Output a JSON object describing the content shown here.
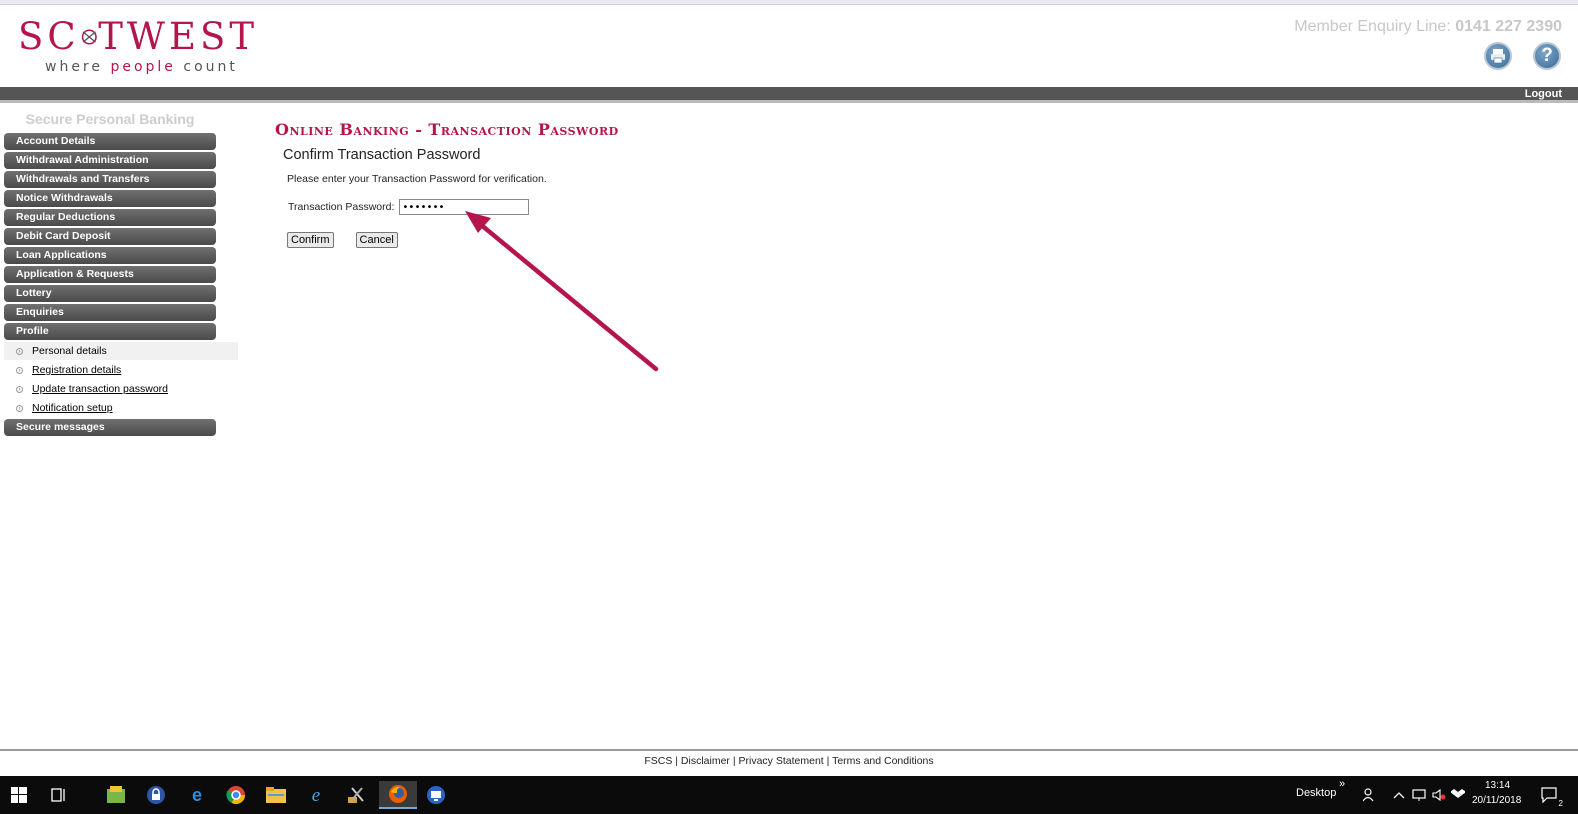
{
  "header": {
    "logo_text_left": "SC",
    "logo_text_right": "TWEST",
    "logo_tagline_a": "where ",
    "logo_tagline_b": "people",
    "logo_tagline_c": " count",
    "enquiry_label": "Member Enquiry Line: ",
    "enquiry_number": "0141 227 2390",
    "print_icon": "print-icon",
    "help_icon": "help-icon"
  },
  "logout_label": "Logout",
  "sidebar": {
    "title": "Secure Personal Banking",
    "menu": [
      "Account Details",
      "Withdrawal Administration",
      "Withdrawals and Transfers",
      "Notice Withdrawals",
      "Regular Deductions",
      "Debit Card Deposit",
      "Loan Applications",
      "Application & Requests",
      "Lottery",
      "Enquiries",
      "Profile"
    ],
    "profile_sub": [
      "Personal details",
      "Registration details",
      "Update transaction password",
      "Notification setup"
    ],
    "last_menu": "Secure messages"
  },
  "main": {
    "title": "Online Banking - Transaction Password",
    "section_title": "Confirm Transaction Password",
    "description": "Please enter your Transaction Password for verification.",
    "password_label": "Transaction Password:",
    "password_value": "•••••••",
    "confirm_label": "Confirm",
    "cancel_label": "Cancel"
  },
  "annotation_color": "#b5154d",
  "footer": {
    "links": [
      "FSCS",
      "Disclaimer",
      "Privacy Statement",
      "Terms and Conditions"
    ],
    "separator": " | "
  },
  "taskbar": {
    "desktop_label": "Desktop",
    "chevron": "»",
    "time": "13:14",
    "date": "20/11/2018",
    "notification_count": "2"
  }
}
